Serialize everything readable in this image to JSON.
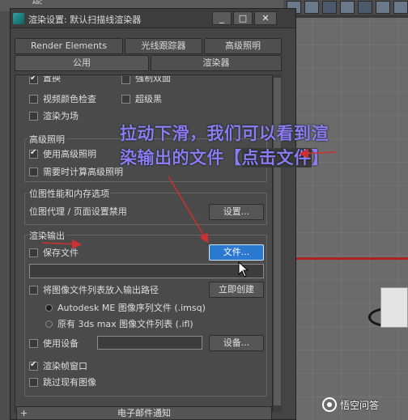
{
  "dialog": {
    "title": "渲染设置: 默认扫描线渲染器",
    "window_buttons": [
      "_",
      "□",
      "✕"
    ]
  },
  "tabs": {
    "row1": [
      "Render Elements",
      "光线跟踪器",
      "高级照明"
    ],
    "row2": [
      "公用",
      "渲染器"
    ]
  },
  "options": {
    "truncated_items": [
      "置换",
      "强制双面"
    ],
    "video_color_check": "视频颜色检查",
    "super_black": "超级黑",
    "render_to_fields": "渲染为场"
  },
  "advanced_lighting": {
    "title": "高级照明",
    "use": "使用高级照明",
    "compute_when_required": "需要时计算高级照明"
  },
  "bitmap_memory": {
    "title": "位图性能和内存选项",
    "status": "位图代理 / 页面设置禁用",
    "setup_button": "设置..."
  },
  "render_output": {
    "title": "渲染输出",
    "save_file": "保存文件",
    "files_button": "文件...",
    "put_image_list": "将图像文件列表放入输出路径",
    "create_now_button": "立即创建",
    "radio_autodesk": "Autodesk ME 图像序列文件 (.imsq)",
    "radio_legacy": "原有 3ds max 图像文件列表 (.ifl)",
    "use_device": "使用设备",
    "devices_button": "设备...",
    "rendered_frame_window": "渲染帧窗口",
    "skip_existing": "跳过现有图像"
  },
  "rollout": {
    "label": "电子邮件通知",
    "toggle": "+"
  },
  "annotation": {
    "line1": "拉动下滑，我们可以看到渲",
    "line2_part1": "染输出的文件【",
    "line2_highlight": "点击文件",
    "line2_part2": "】"
  },
  "watermark": "悟空问答",
  "background": {
    "abc_label": "ABC"
  },
  "colors": {
    "annotation_text": "#8c7cf2",
    "arrow": "#d03030",
    "highlight_button": "#2a78d0",
    "dialog_bg": "#444444"
  },
  "state": {
    "checked": [
      "置换",
      "使用高级照明",
      "渲染帧窗口"
    ],
    "selected_radio": "Autodesk ME 图像序列文件 (.imsq)"
  }
}
